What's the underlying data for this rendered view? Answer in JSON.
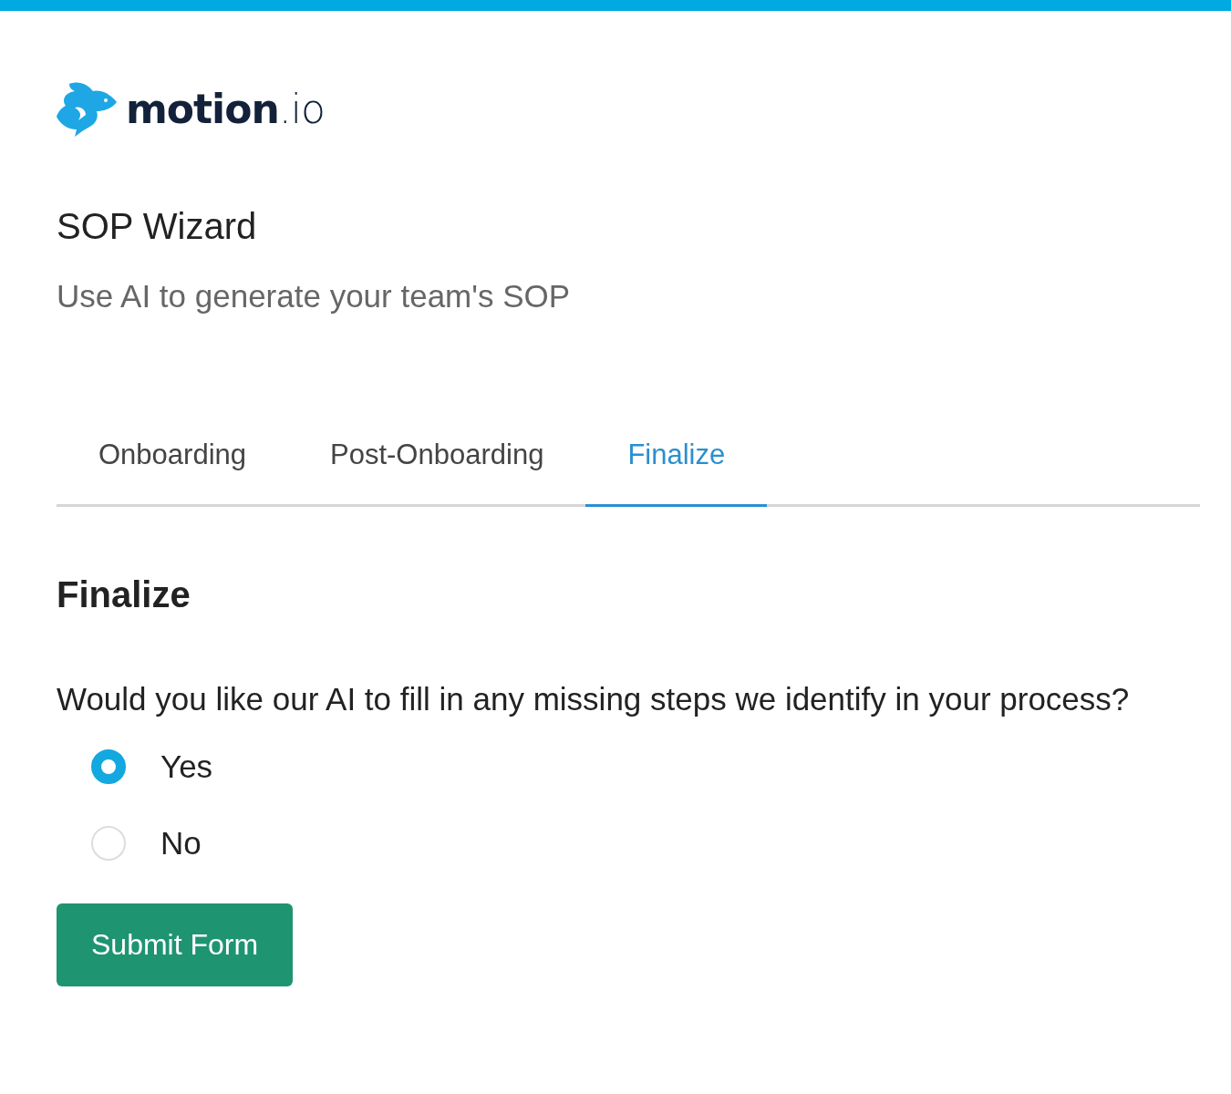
{
  "logo": {
    "text": "**motion**.io"
  },
  "header": {
    "title": "SOP Wizard",
    "subtitle": "Use AI to generate your team's SOP"
  },
  "tabs": [
    {
      "label": "Onboarding",
      "selected": false
    },
    {
      "label": "Post-Onboarding",
      "selected": false
    },
    {
      "label": "Finalize",
      "selected": true
    }
  ],
  "section": {
    "title": "Finalize",
    "question": "Would you like our AI to fill in any missing steps we identify in your process?",
    "options": [
      {
        "label": "Yes",
        "selected": true
      },
      {
        "label": "No",
        "selected": false
      }
    ]
  },
  "buttons": [
    "Submit Form"
  ]
}
